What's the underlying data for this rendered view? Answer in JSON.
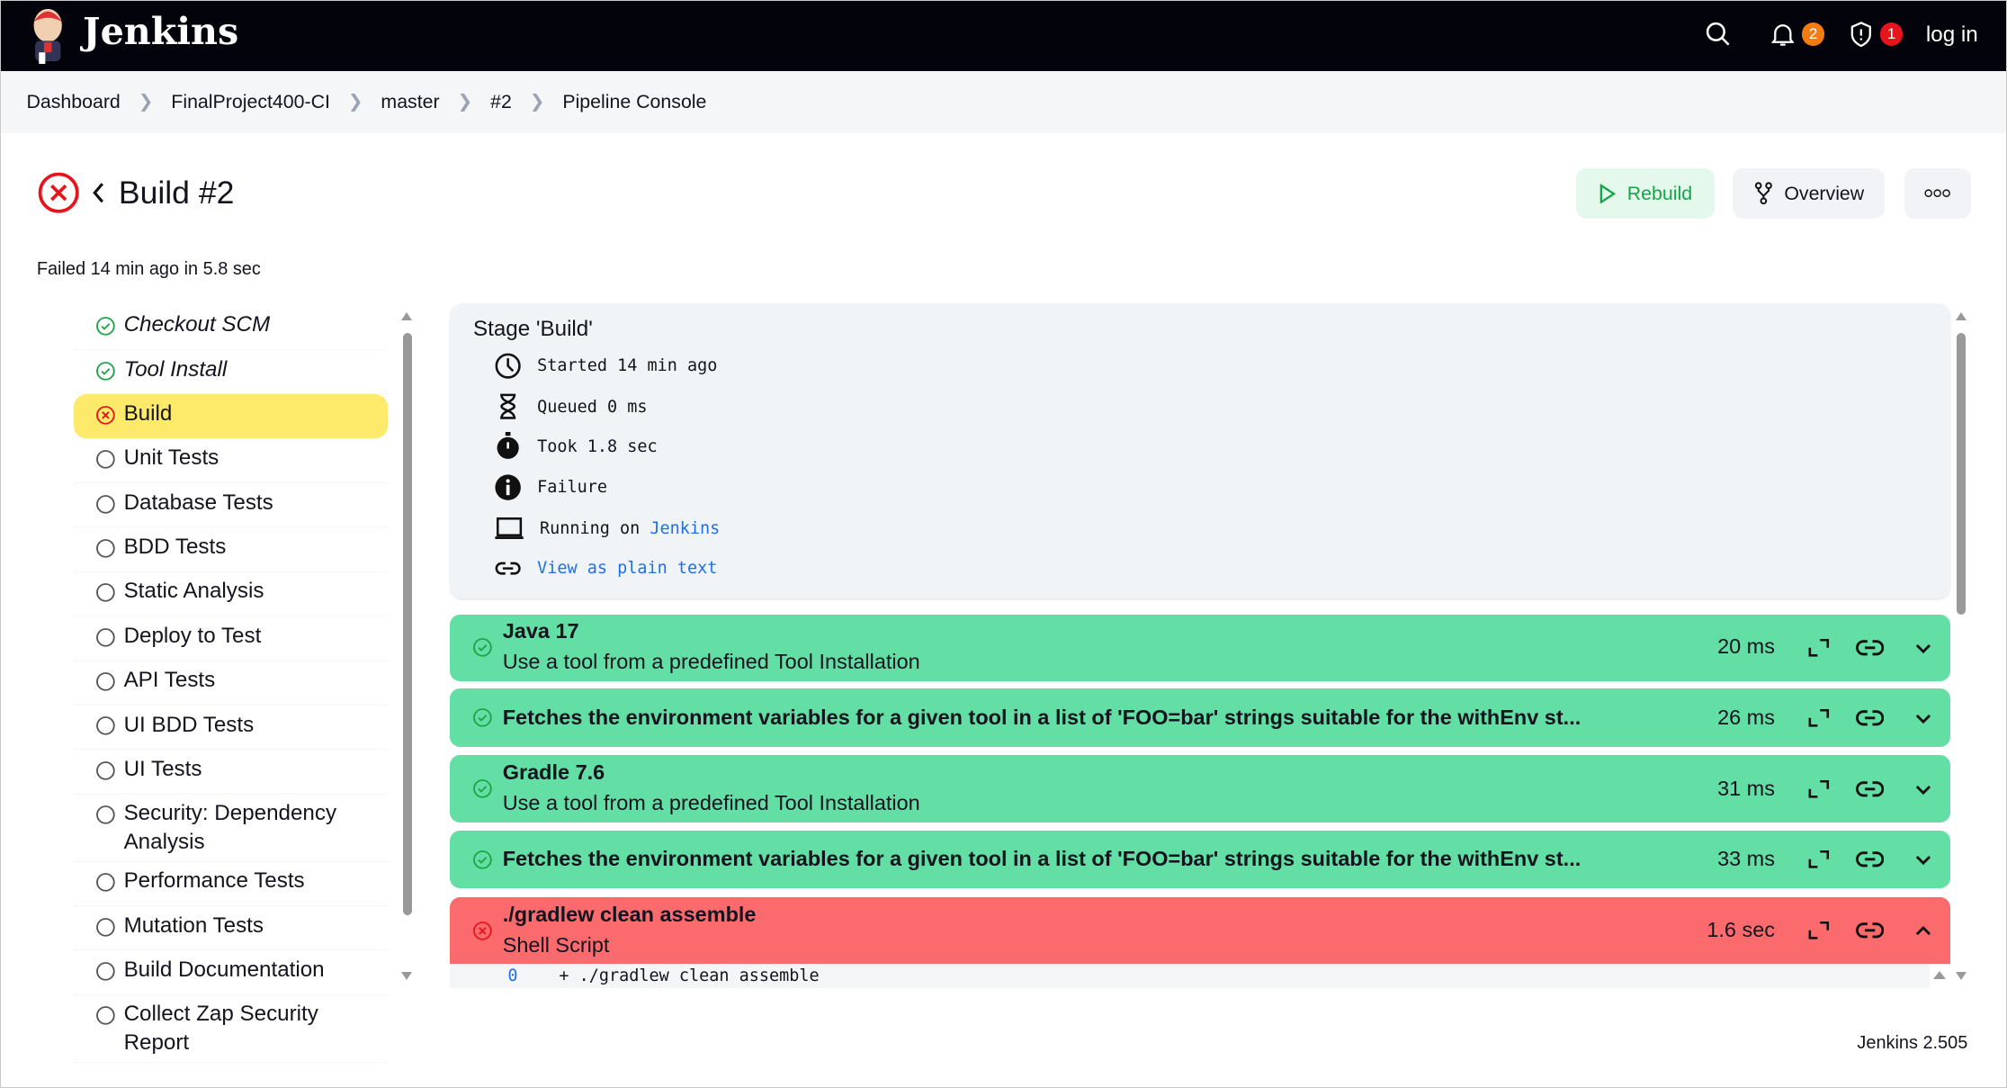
{
  "header": {
    "brand": "Jenkins",
    "notifications_count": "2",
    "security_count": "1",
    "login": "log in"
  },
  "breadcrumbs": [
    "Dashboard",
    "FinalProject400-CI",
    "master",
    "#2",
    "Pipeline Console"
  ],
  "build": {
    "title": "Build #2",
    "status": "failed",
    "summary": "Failed 14 min ago in 5.8 sec"
  },
  "actions": {
    "rebuild": "Rebuild",
    "overview": "Overview"
  },
  "stages": [
    {
      "label": "Checkout SCM",
      "status": "success",
      "italic": true
    },
    {
      "label": "Tool Install",
      "status": "success",
      "italic": true
    },
    {
      "label": "Build",
      "status": "failed",
      "selected": true
    },
    {
      "label": "Unit Tests",
      "status": "not-run"
    },
    {
      "label": "Database Tests",
      "status": "not-run"
    },
    {
      "label": "BDD Tests",
      "status": "not-run"
    },
    {
      "label": "Static Analysis",
      "status": "not-run"
    },
    {
      "label": "Deploy to Test",
      "status": "not-run"
    },
    {
      "label": "API Tests",
      "status": "not-run"
    },
    {
      "label": "UI BDD Tests",
      "status": "not-run"
    },
    {
      "label": "UI Tests",
      "status": "not-run"
    },
    {
      "label": "Security: Dependency Analysis",
      "status": "not-run"
    },
    {
      "label": "Performance Tests",
      "status": "not-run"
    },
    {
      "label": "Mutation Tests",
      "status": "not-run"
    },
    {
      "label": "Build Documentation",
      "status": "not-run"
    },
    {
      "label": "Collect Zap Security Report",
      "status": "not-run"
    }
  ],
  "stage_detail": {
    "heading": "Stage 'Build'",
    "started": "Started 14 min ago",
    "queued": "Queued 0 ms",
    "took": "Took 1.8 sec",
    "result": "Failure",
    "running_prefix": "Running on ",
    "agent": "Jenkins",
    "plain_text": "View as plain text"
  },
  "steps": [
    {
      "title": "Java 17",
      "desc": "Use a tool from a predefined Tool Installation",
      "duration": "20 ms",
      "status": "success"
    },
    {
      "title": "Fetches the environment variables for a given tool in a list of 'FOO=bar' strings suitable for the withEnv st...",
      "duration": "26 ms",
      "status": "success"
    },
    {
      "title": "Gradle 7.6",
      "desc": "Use a tool from a predefined Tool Installation",
      "duration": "31 ms",
      "status": "success"
    },
    {
      "title": "Fetches the environment variables for a given tool in a list of 'FOO=bar' strings suitable for the withEnv st...",
      "duration": "33 ms",
      "status": "success"
    },
    {
      "title": "./gradlew clean assemble",
      "desc": "Shell Script",
      "duration": "1.6 sec",
      "status": "failed",
      "expanded": true
    }
  ],
  "console": [
    {
      "line": "0",
      "text": "+ ./gradlew clean assemble"
    }
  ],
  "footer": {
    "version": "Jenkins 2.505"
  },
  "colors": {
    "success": "#63dea4",
    "failed": "#fb6b6e",
    "selected": "#fdea6a",
    "link": "#1f6feb"
  }
}
